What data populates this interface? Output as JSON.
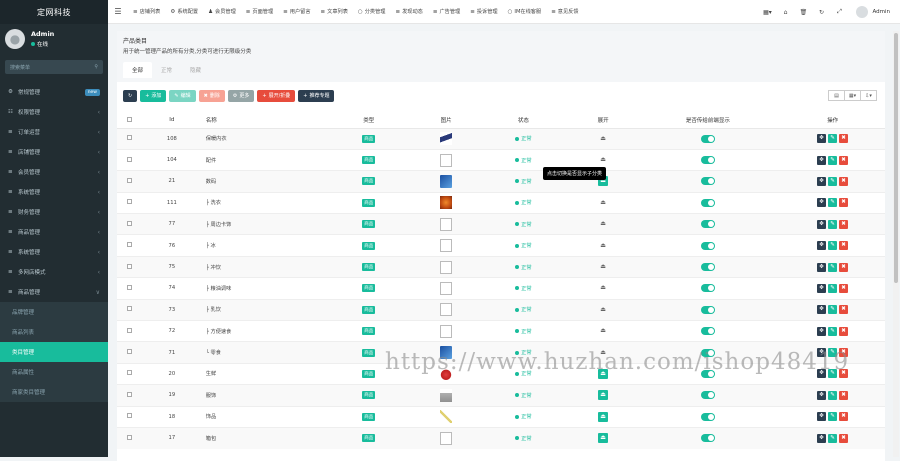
{
  "sidebar": {
    "logo": "定网科技",
    "user": {
      "name": "Admin",
      "status": "在线"
    },
    "search_placeholder": "搜索菜单",
    "items": [
      {
        "label": "常规管理",
        "icon": "cogs-icon",
        "badge": "new"
      },
      {
        "label": "权限管理",
        "icon": "group-icon",
        "arrow": "‹"
      },
      {
        "label": "订单运营",
        "icon": "list-icon",
        "arrow": "‹"
      },
      {
        "label": "店铺管理",
        "icon": "list-icon",
        "arrow": "‹"
      },
      {
        "label": "会员管理",
        "icon": "list-icon",
        "arrow": "‹"
      },
      {
        "label": "系统管理",
        "icon": "list-icon",
        "arrow": "‹"
      },
      {
        "label": "财务管理",
        "icon": "list-icon",
        "arrow": "‹"
      },
      {
        "label": "商品管理",
        "icon": "list-icon",
        "arrow": "‹"
      },
      {
        "label": "系统管理",
        "icon": "list-icon",
        "arrow": "‹"
      },
      {
        "label": "多网店模式",
        "icon": "list-icon",
        "arrow": "‹"
      },
      {
        "label": "商品管理",
        "icon": "list-icon",
        "arrow": "∨"
      }
    ],
    "subitems": [
      {
        "label": "品牌管理",
        "active": false
      },
      {
        "label": "商品列表",
        "active": false
      },
      {
        "label": "类目管理",
        "active": true
      },
      {
        "label": "商品属性",
        "active": false
      },
      {
        "label": "商家类目管理",
        "active": false
      }
    ]
  },
  "topbar": {
    "tabs": [
      {
        "icon": "list-icon",
        "label": "店铺列表"
      },
      {
        "icon": "gear-icon",
        "label": "系统配置"
      },
      {
        "icon": "user-icon",
        "label": "会员管理"
      },
      {
        "icon": "list-icon",
        "label": "页面管理"
      },
      {
        "icon": "list-icon",
        "label": "用户留言"
      },
      {
        "icon": "list-icon",
        "label": "文章列表"
      },
      {
        "icon": "circle-icon",
        "label": "分类管理"
      },
      {
        "icon": "list-icon",
        "label": "发现动态"
      },
      {
        "icon": "list-icon",
        "label": "广告管理"
      },
      {
        "icon": "list-icon",
        "label": "投诉管理"
      },
      {
        "icon": "circle-icon",
        "label": "IM在线客服"
      },
      {
        "icon": "list-icon",
        "label": "意见反馈"
      }
    ],
    "admin": "Admin"
  },
  "panel": {
    "title": "产品类目",
    "description": "用于统一管理产品的所有分类,分类可进行无限级分类",
    "tabs": [
      "全部",
      "正常",
      "隐藏"
    ],
    "toolbar": [
      {
        "label": "",
        "icon": "refresh-icon",
        "color": "#2c3e50"
      },
      {
        "label": "添加",
        "icon": "plus-icon",
        "color": "#18bc9c"
      },
      {
        "label": "编辑",
        "icon": "pencil-icon",
        "color": "#7bd5c3"
      },
      {
        "label": "删除",
        "icon": "trash-icon",
        "color": "#f7a294"
      },
      {
        "label": "更多",
        "icon": "cog-icon",
        "color": "#95a5a6"
      },
      {
        "label": "展开/折叠",
        "icon": "plus-icon",
        "color": "#e74c3c"
      },
      {
        "label": "推荐专题",
        "icon": "plus-icon",
        "color": "#2c3e50"
      }
    ],
    "columns": [
      "Id",
      "名称",
      "类型",
      "图片",
      "状态",
      "操作",
      "是否传给前端显示",
      "操作"
    ],
    "column_ext": "展开",
    "rows": [
      {
        "id": "108",
        "name": "保暖内衣",
        "type": "商品",
        "img": "figure",
        "status": "正常",
        "expand": false
      },
      {
        "id": "104",
        "name": "配件",
        "type": "商品",
        "img": "broken",
        "status": "正常",
        "expand": false
      },
      {
        "id": "21",
        "name": "数码",
        "type": "商品",
        "img": "phone",
        "status": "正常",
        "expand": true
      },
      {
        "id": "111",
        "name": "├ 洗衣",
        "type": "商品",
        "img": "orange",
        "status": "正常",
        "expand": false
      },
      {
        "id": "77",
        "name": "├ 周边卡饰",
        "type": "商品",
        "img": "broken",
        "status": "正常",
        "expand": false
      },
      {
        "id": "76",
        "name": "├ 冰",
        "type": "商品",
        "img": "broken",
        "status": "正常",
        "expand": false
      },
      {
        "id": "75",
        "name": "├ 冲饮",
        "type": "商品",
        "img": "broken",
        "status": "正常",
        "expand": false
      },
      {
        "id": "74",
        "name": "├ 粮油调味",
        "type": "商品",
        "img": "broken",
        "status": "正常",
        "expand": false
      },
      {
        "id": "73",
        "name": "├ 乳饮",
        "type": "商品",
        "img": "broken",
        "status": "正常",
        "expand": false
      },
      {
        "id": "72",
        "name": "├ 方便速食",
        "type": "商品",
        "img": "broken",
        "status": "正常",
        "expand": false
      },
      {
        "id": "71",
        "name": "└ 零食",
        "type": "商品",
        "img": "phone",
        "status": "正常",
        "expand": false
      },
      {
        "id": "20",
        "name": "生鲜",
        "type": "商品",
        "img": "crab",
        "status": "正常",
        "expand": true
      },
      {
        "id": "19",
        "name": "服饰",
        "type": "商品",
        "img": "bag",
        "status": "正常",
        "expand": true
      },
      {
        "id": "18",
        "name": "饰品",
        "type": "商品",
        "img": "pen",
        "status": "正常",
        "expand": true
      },
      {
        "id": "17",
        "name": "箱包",
        "type": "商品",
        "img": "broken",
        "status": "正常",
        "expand": true
      }
    ],
    "tooltip": "点击切换是否显示子分类",
    "watermark": "https://www.huzhan.com/ishop48419"
  },
  "colors": {
    "primary": "#18bc9c",
    "sidebar": "#222d32",
    "danger": "#e74c3c",
    "dark": "#2c3e50"
  }
}
